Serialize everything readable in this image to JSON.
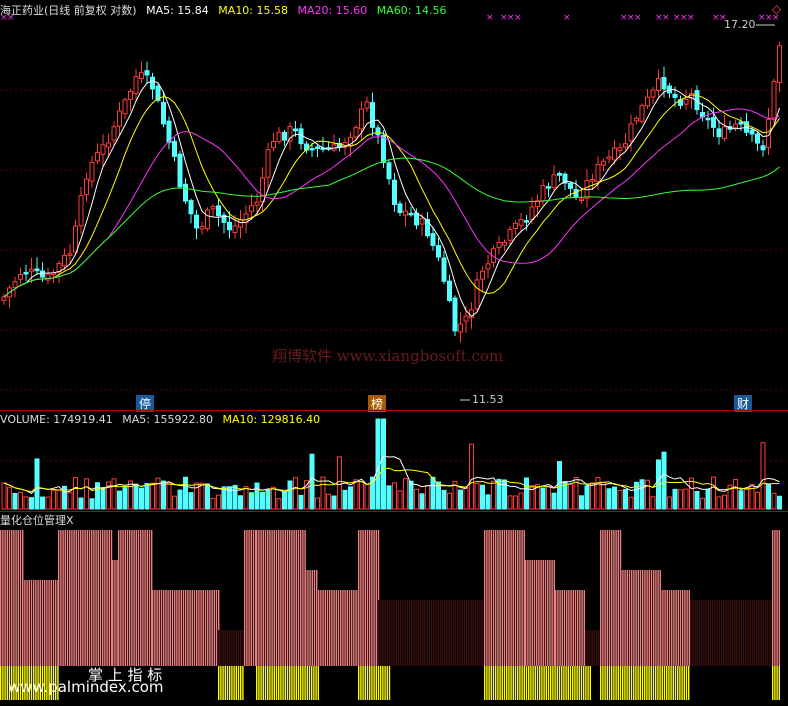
{
  "price_panel": {
    "stock_title": "海正药业(日线 前复权 对数)",
    "indicators": [
      {
        "label": "MA5: 15.84",
        "color": "#ffffff"
      },
      {
        "label": "MA10: 15.58",
        "color": "#ffff00"
      },
      {
        "label": "MA20: 15.60",
        "color": "#ff33ff"
      },
      {
        "label": "MA60: 14.56",
        "color": "#33ff33"
      }
    ],
    "high_label": "17.20",
    "low_label": "11.53",
    "event_tags": [
      "停",
      "榜",
      "财"
    ],
    "watermark": "翔博软件 www.xiangbosoft.com",
    "marker_symbol": "×"
  },
  "volume_panel": {
    "title": "VOLUME: 174919.41",
    "ma5": "MA5: 155922.80",
    "ma10": "MA10: 129816.40"
  },
  "position_panel": {
    "title": "量化仓位管理",
    "close_symbol": "X",
    "watermark_cn": "掌 上 指 标",
    "watermark_url": "www.palmindex.com"
  },
  "colors": {
    "up": "#ff3b3b",
    "down": "#54ffff",
    "ma5": "#ffffff",
    "ma10": "#ffff00",
    "ma20": "#ff33ff",
    "ma60": "#33ff33",
    "position_bar": "#f08080",
    "position_base": "#ffff00"
  }
}
